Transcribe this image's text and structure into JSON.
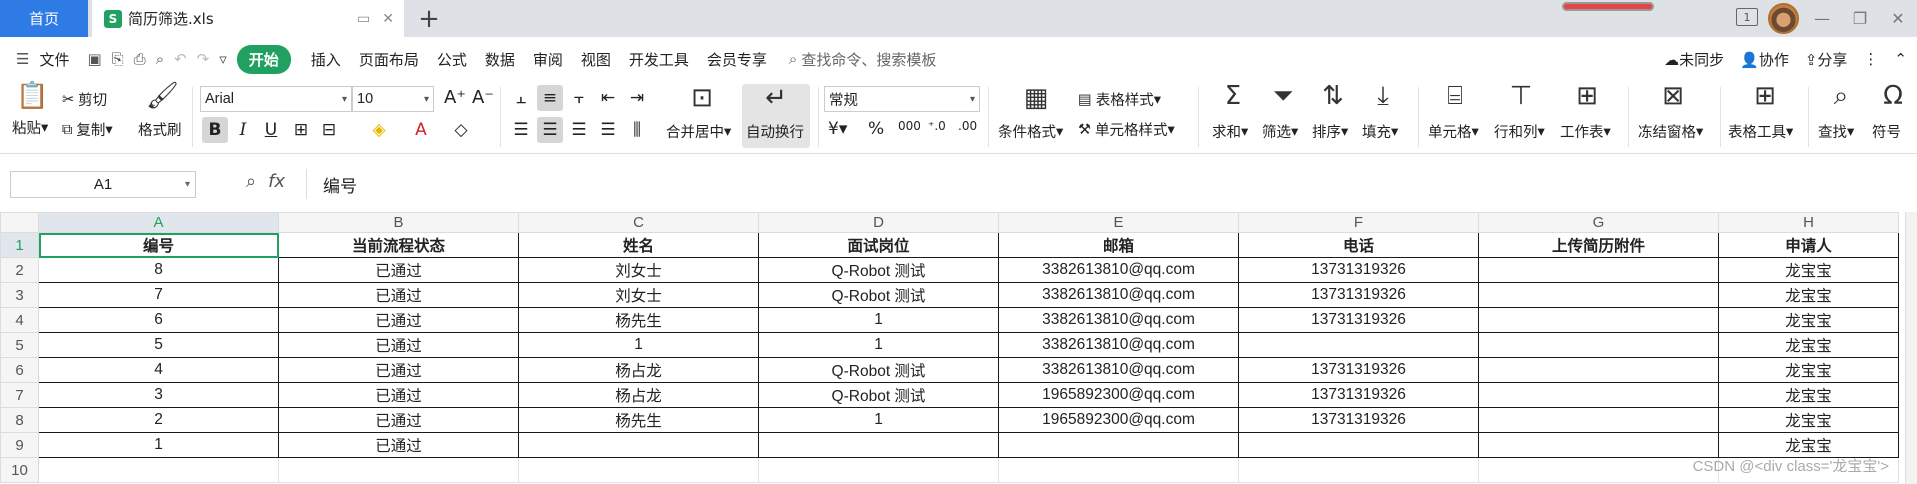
{
  "titlebar": {
    "home_tab": "首页",
    "file_tab": "简历筛选.xls",
    "file_icon": "S",
    "add_tab": "+",
    "tile_badge": "1",
    "win_min": "—",
    "win_max": "❐",
    "win_close": "✕"
  },
  "menubar": {
    "file": "文件",
    "start": "开始",
    "items": [
      "插入",
      "页面布局",
      "公式",
      "数据",
      "审阅",
      "视图",
      "开发工具",
      "会员专享"
    ],
    "search": "查找命令、搜索模板",
    "sync": "未同步",
    "collab": "协作",
    "share": "分享"
  },
  "ribbon": {
    "paste": "粘贴",
    "cut": "剪切",
    "copy": "复制",
    "format_painter": "格式刷",
    "font_name": "Arial",
    "font_size": "10",
    "merge_center": "合并居中",
    "wrap_text": "自动换行",
    "number_format": "常规",
    "conditional_format": "条件格式",
    "table_style": "表格样式",
    "cell_style": "单元格样式",
    "sum": "求和",
    "filter": "筛选",
    "sort": "排序",
    "fill": "填充",
    "cell": "单元格",
    "row_col": "行和列",
    "worksheet": "工作表",
    "freeze": "冻结窗格",
    "table_tools": "表格工具",
    "find": "查找",
    "symbol": "符号"
  },
  "formula_bar": {
    "cell_ref": "A1",
    "fx": "fx",
    "value": "编号"
  },
  "sheet": {
    "columns": [
      "A",
      "B",
      "C",
      "D",
      "E",
      "F",
      "G",
      "H"
    ],
    "header_row": [
      "编号",
      "当前流程状态",
      "姓名",
      "面试岗位",
      "邮箱",
      "电话",
      "上传简历附件",
      "申请人"
    ],
    "rows": [
      [
        "8",
        "已通过",
        "刘女士",
        "Q-Robot 测试",
        "3382613810@qq.com",
        "13731319326",
        "",
        "龙宝宝"
      ],
      [
        "7",
        "已通过",
        "刘女士",
        "Q-Robot 测试",
        "3382613810@qq.com",
        "13731319326",
        "",
        "龙宝宝"
      ],
      [
        "6",
        "已通过",
        "杨先生",
        "1",
        "3382613810@qq.com",
        "13731319326",
        "",
        "龙宝宝"
      ],
      [
        "5",
        "已通过",
        "1",
        "1",
        "3382613810@qq.com",
        "",
        "",
        "龙宝宝"
      ],
      [
        "4",
        "已通过",
        "杨占龙",
        "Q-Robot 测试",
        "3382613810@qq.com",
        "13731319326",
        "",
        "龙宝宝"
      ],
      [
        "3",
        "已通过",
        "杨占龙",
        "Q-Robot 测试",
        "1965892300@qq.com",
        "13731319326",
        "",
        "龙宝宝"
      ],
      [
        "2",
        "已通过",
        "杨先生",
        "1",
        "1965892300@qq.com",
        "13731319326",
        "",
        "龙宝宝"
      ],
      [
        "1",
        "已通过",
        "",
        "",
        "",
        "",
        "",
        "龙宝宝"
      ]
    ],
    "row_numbers": [
      "1",
      "2",
      "3",
      "4",
      "5",
      "6",
      "7",
      "8",
      "9",
      "10"
    ]
  },
  "watermark": "CSDN @<div class='龙宝宝'>",
  "colors": {
    "accent": "#20a162",
    "home_tab": "#2e7be6"
  }
}
